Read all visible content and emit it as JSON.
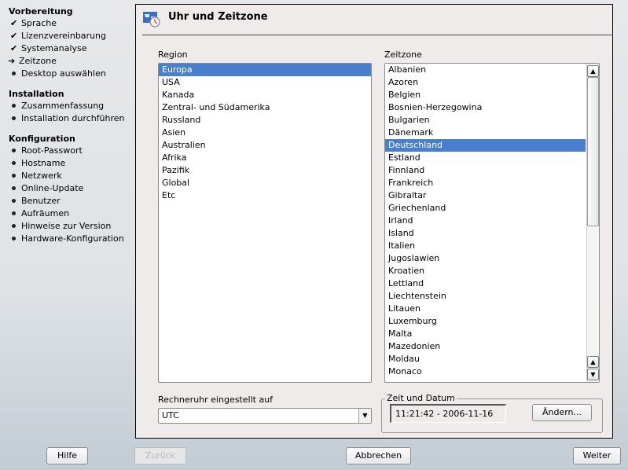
{
  "sidebar": {
    "sections": [
      {
        "title": "Vorbereitung",
        "items": [
          {
            "label": "Sprache",
            "state": "done"
          },
          {
            "label": "Lizenzvereinbarung",
            "state": "done"
          },
          {
            "label": "Systemanalyse",
            "state": "done"
          },
          {
            "label": "Zeitzone",
            "state": "current"
          },
          {
            "label": "Desktop auswählen",
            "state": "todo"
          }
        ]
      },
      {
        "title": "Installation",
        "items": [
          {
            "label": "Zusammenfassung"
          },
          {
            "label": "Installation durchführen"
          }
        ]
      },
      {
        "title": "Konfiguration",
        "items": [
          {
            "label": "Root-Passwort"
          },
          {
            "label": "Hostname"
          },
          {
            "label": "Netzwerk"
          },
          {
            "label": "Online-Update"
          },
          {
            "label": "Benutzer"
          },
          {
            "label": "Aufräumen"
          },
          {
            "label": "Hinweise zur Version"
          },
          {
            "label": "Hardware-Konfiguration"
          }
        ]
      }
    ]
  },
  "header": {
    "title": "Uhr und Zeitzone",
    "icon": "clock-timezone-icon"
  },
  "region": {
    "label": "Region",
    "selected": "Europa",
    "items": [
      "Europa",
      "USA",
      "Kanada",
      "Zentral- und Südamerika",
      "Russland",
      "Asien",
      "Australien",
      "Afrika",
      "Pazifik",
      "Global",
      "Etc"
    ]
  },
  "zone": {
    "label": "Zeitzone",
    "selected": "Deutschland",
    "items": [
      "Albanien",
      "Azoren",
      "Belgien",
      "Bosnien-Herzegowina",
      "Bulgarien",
      "Dänemark",
      "Deutschland",
      "Estland",
      "Finnland",
      "Frankreich",
      "Gibraltar",
      "Griechenland",
      "Irland",
      "Island",
      "Italien",
      "Jugoslawien",
      "Kroatien",
      "Lettland",
      "Liechtenstein",
      "Litauen",
      "Luxemburg",
      "Malta",
      "Mazedonien",
      "Moldau",
      "Monaco"
    ]
  },
  "hwclock": {
    "label": "Rechneruhr eingestellt auf",
    "value": "UTC"
  },
  "datetime": {
    "group_label": "Zeit und Datum",
    "value": "11:21:42 - 2006-11-16",
    "change_label": "Ändern..."
  },
  "footer": {
    "help": "Hilfe",
    "back": "Zurück",
    "abort": "Abbrechen",
    "next": "Weiter"
  },
  "colors": {
    "selection": "#4a7fd0"
  }
}
